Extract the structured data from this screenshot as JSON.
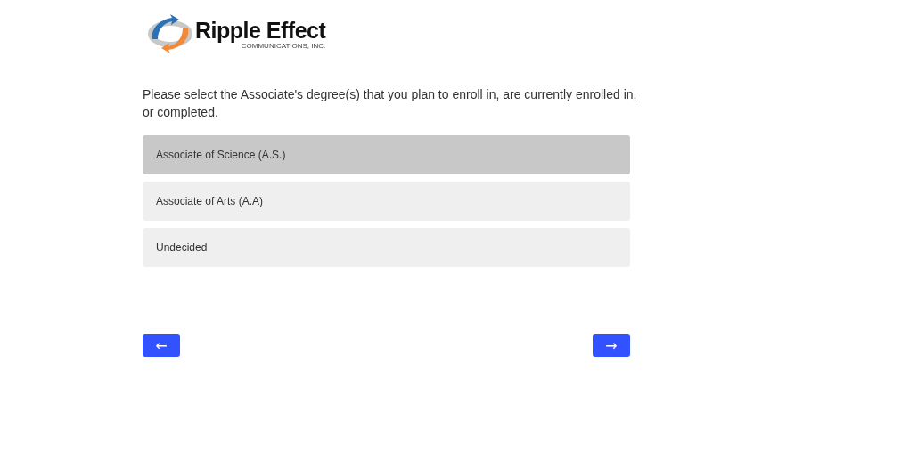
{
  "logo": {
    "name": "Ripple Effect",
    "subtitle": "COMMUNICATIONS, INC."
  },
  "question": "Please select the Associate's degree(s) that you plan to enroll in, are currently enrolled in, or completed.",
  "options": [
    {
      "label": "Associate of Science (A.S.)",
      "selected": true
    },
    {
      "label": "Associate of Arts (A.A)",
      "selected": false
    },
    {
      "label": "Undecided",
      "selected": false
    }
  ],
  "navigation": {
    "back": "←",
    "next": "→"
  }
}
